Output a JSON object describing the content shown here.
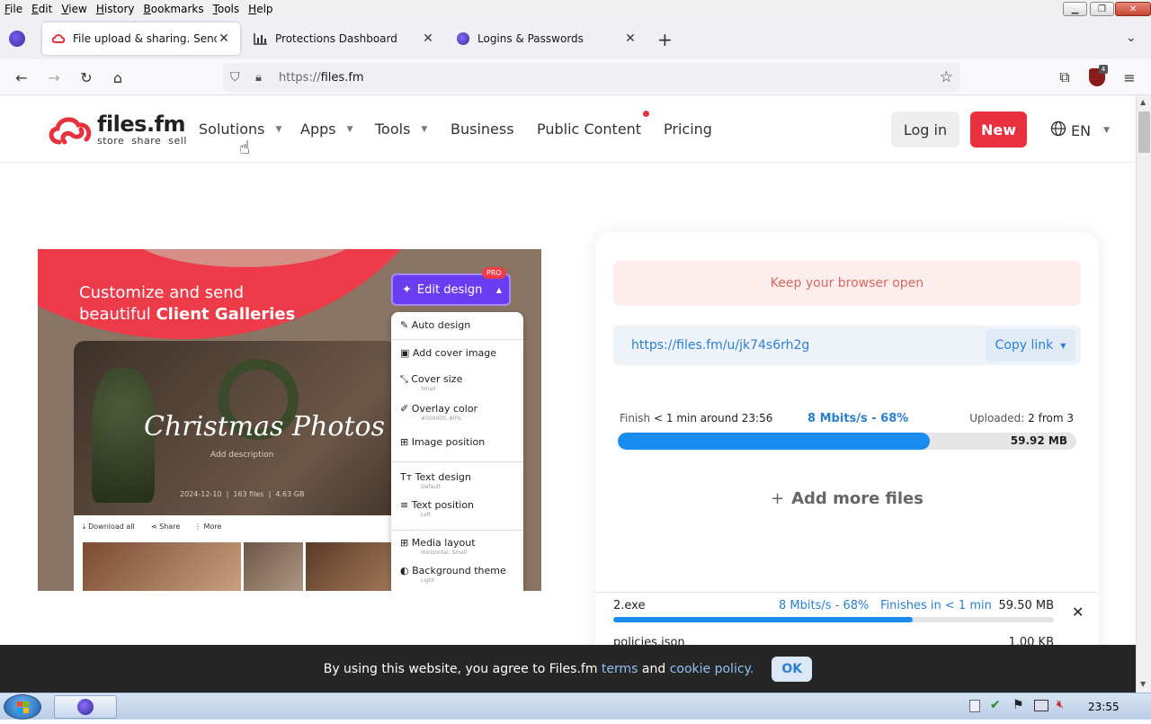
{
  "menubar": {
    "items": [
      {
        "ul": "F",
        "rest": "ile"
      },
      {
        "ul": "E",
        "rest": "dit"
      },
      {
        "ul": "V",
        "rest": "iew"
      },
      {
        "ul": "H",
        "rest": "istory"
      },
      {
        "ul": "B",
        "rest": "ookmarks"
      },
      {
        "ul": "T",
        "rest": "ools"
      },
      {
        "ul": "H",
        "rest": "elp"
      }
    ]
  },
  "tabs": [
    {
      "label": "File upload & sharing. Send large files",
      "icon": "filesfm-icon",
      "active": true
    },
    {
      "label": "Protections Dashboard",
      "icon": "chart-icon",
      "active": false
    },
    {
      "label": "Logins & Passwords",
      "icon": "firefox-icon",
      "active": false
    }
  ],
  "urlbar": {
    "scheme": "https://",
    "host": "files.fm"
  },
  "site": {
    "logo": {
      "name": "files.fm",
      "tagline": "store  share  sell"
    },
    "nav": [
      {
        "label": "Solutions",
        "caret": true
      },
      {
        "label": "Apps",
        "caret": true
      },
      {
        "label": "Tools",
        "caret": true
      },
      {
        "label": "Business",
        "caret": false
      },
      {
        "label": "Public Content",
        "caret": false
      },
      {
        "label": "Pricing",
        "caret": false
      }
    ],
    "login": "Log in",
    "new": "New",
    "lang": "EN"
  },
  "promo": {
    "headline1": "Customize and send",
    "headline2a": "beautiful ",
    "headline2b": "Client Galleries",
    "edit_design": "Edit design",
    "pro": "PRO",
    "gallery_title": "Christmas Photos",
    "gallery_desc": "Add description",
    "gallery_meta": "2024-12-10  |  163 files  |  4.63 GB",
    "toolbar": [
      "Download all",
      "Share",
      "More"
    ],
    "menu": [
      {
        "label": "Auto design",
        "sub": ""
      },
      {
        "label": "Add cover image",
        "sub": ""
      },
      {
        "label": "Cover size",
        "sub": "Small"
      },
      {
        "label": "Overlay color",
        "sub": "#000000, 80%"
      },
      {
        "label": "Image position",
        "sub": ""
      },
      {
        "label": "Text design",
        "sub": "Default"
      },
      {
        "label": "Text position",
        "sub": "Left"
      },
      {
        "label": "Media layout",
        "sub": "Horizontal, Small"
      },
      {
        "label": "Background theme",
        "sub": "Light"
      }
    ]
  },
  "upload": {
    "keep_open": "Keep your browser open",
    "link": "https://files.fm/u/jk74s6rh2g",
    "copy_link": "Copy link",
    "finish_label": "Finish",
    "finish_value": "< 1 min around 23:56",
    "speed": "8 Mbits/s - 68%",
    "uploaded_label": "Uploaded:",
    "uploaded_value": "2 from 3",
    "size": "59.92 MB",
    "progress": 0.68,
    "add_more": "Add more files",
    "files": [
      {
        "name": "2.exe",
        "speed": "8 Mbits/s - 68%",
        "finish": "Finishes in < 1 min",
        "size": "59.50 MB",
        "progress": 0.68
      },
      {
        "name": "policies.json",
        "speed": "",
        "finish": "",
        "size": "1.00 KB",
        "progress": 1
      }
    ]
  },
  "cookie": {
    "text1": "By using this website, you agree to Files.fm ",
    "terms": "terms",
    "and": " and ",
    "policy": "cookie policy.",
    "ok": "OK"
  },
  "taskbar": {
    "clock": "23:55"
  },
  "colors": {
    "brand": "#e8303f",
    "link": "#2a7fd4",
    "progress": "#1a8cf0",
    "pro_purple": "#6b3df0"
  }
}
